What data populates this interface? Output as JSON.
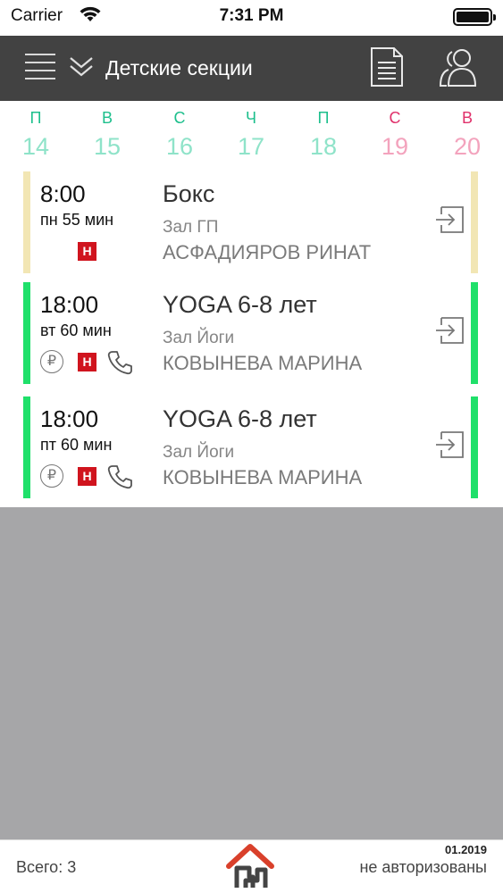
{
  "status_bar": {
    "carrier": "Carrier",
    "time": "7:31 PM"
  },
  "header": {
    "title": "Детские секции",
    "menu_icon": "menu-icon",
    "expand_icon": "chevron-down-icon",
    "doc_icon": "document-icon",
    "user_icon": "users-icon"
  },
  "days": [
    {
      "letter": "П",
      "num": "14",
      "weekend": false
    },
    {
      "letter": "В",
      "num": "15",
      "weekend": false
    },
    {
      "letter": "С",
      "num": "16",
      "weekend": false
    },
    {
      "letter": "Ч",
      "num": "17",
      "weekend": false
    },
    {
      "letter": "П",
      "num": "18",
      "weekend": false
    },
    {
      "letter": "С",
      "num": "19",
      "weekend": true
    },
    {
      "letter": "В",
      "num": "20",
      "weekend": true
    }
  ],
  "colors": {
    "weekday_letter": "#1dbf8c",
    "weekday_num": "#8fe3c9",
    "weekend_letter": "#e0306a",
    "weekend_num": "#f3a3bd",
    "status_beige": "#f2e6b4",
    "status_green": "#1fe06a",
    "badge_red": "#d0141e",
    "home_red": "#d9402b"
  },
  "sessions": [
    {
      "time": "8:00",
      "duration": "пн 55 мин",
      "title": "Бокс",
      "hall": "Зал ГП",
      "coach": "АСФАДИЯРОВ РИНАТ",
      "status_color": "#f2e6b4",
      "paid_icon": false,
      "new_badge": "Н",
      "phone_icon": false
    },
    {
      "time": "18:00",
      "duration": "вт 60 мин",
      "title": "YOGA 6-8 лет",
      "hall": "Зал Йоги",
      "coach": "КОВЫНЕВА МАРИНА",
      "status_color": "#1fe06a",
      "paid_icon": true,
      "new_badge": "Н",
      "phone_icon": true
    },
    {
      "time": "18:00",
      "duration": "пт 60 мин",
      "title": "YOGA 6-8 лет",
      "hall": "Зал Йоги",
      "coach": "КОВЫНЕВА МАРИНА",
      "status_color": "#1fe06a",
      "paid_icon": true,
      "new_badge": "Н",
      "phone_icon": true
    }
  ],
  "footer": {
    "total": "Всего: 3",
    "period": "01.2019",
    "auth": "не авторизованы",
    "home_icon": "home-icon"
  }
}
